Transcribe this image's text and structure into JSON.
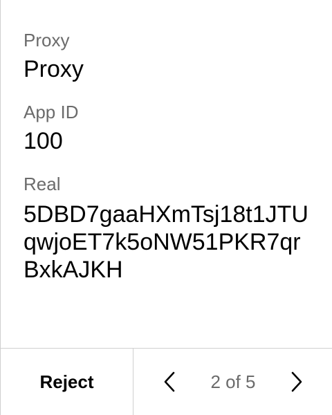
{
  "fields": [
    {
      "label": "Proxy",
      "value": "Proxy"
    },
    {
      "label": "App ID",
      "value": "100"
    },
    {
      "label": "Real",
      "value": "5DBD7gaaHXmTsj18t1JTUqwjoET7k5oNW51PKR7qrBxkAJKH"
    }
  ],
  "footer": {
    "reject_label": "Reject",
    "page_indicator": "2 of 5",
    "prev_icon": "chevron-left-icon",
    "next_icon": "chevron-right-icon"
  },
  "colors": {
    "label": "#6b6b6b",
    "value": "#000000",
    "divider": "#cfcfcf"
  }
}
